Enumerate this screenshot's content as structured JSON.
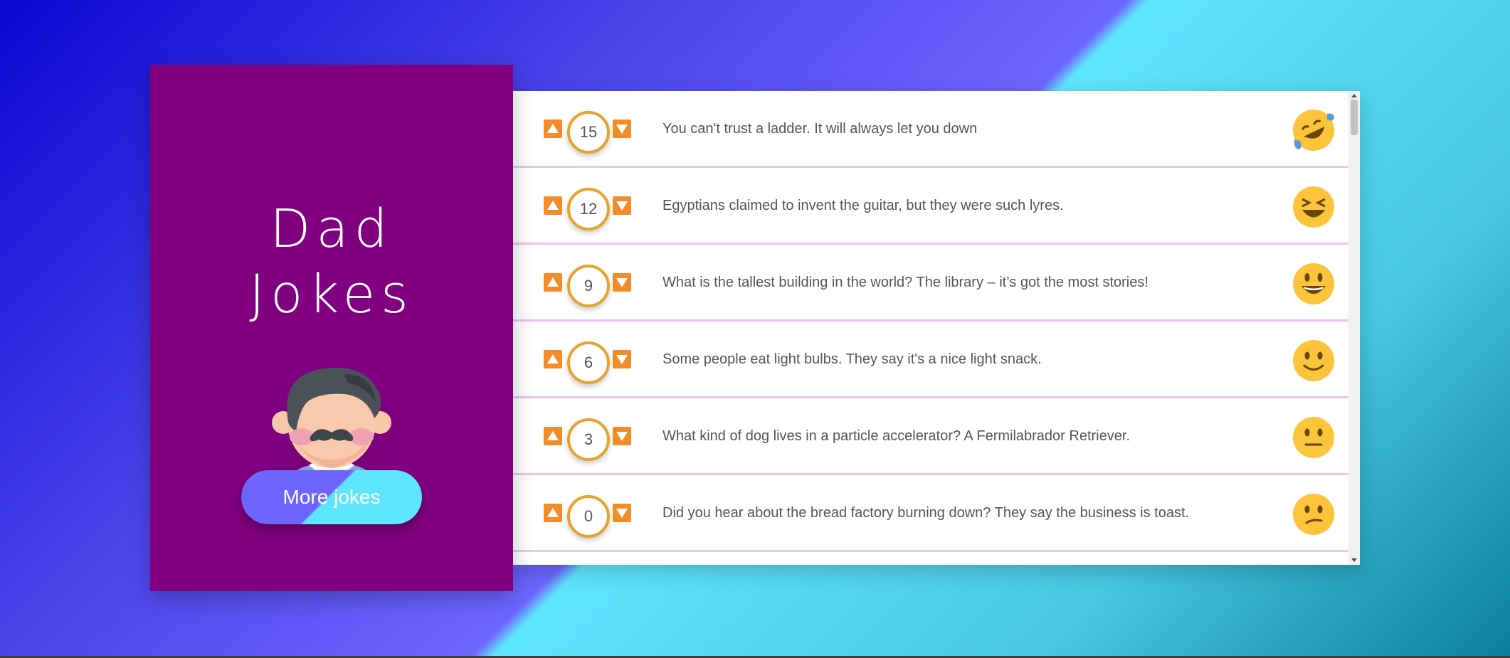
{
  "app": {
    "title_line1": "Dad",
    "title_line2": "Jokes",
    "more_button_label": "More jokes"
  },
  "colors": {
    "sidebar": "#800080",
    "accent_purple": "#6e65ff",
    "accent_cyan": "#5fe6ff",
    "score_border": "#e5a32d",
    "vote_arrow": "#f28c28",
    "row_divider": "#e9c6ea"
  },
  "jokes": [
    {
      "score": "15",
      "text": "You can't trust a ladder. It will always let you down",
      "emoji": "rolling-on-floor-laughing-icon"
    },
    {
      "score": "12",
      "text": "Egyptians claimed to invent the guitar, but they were such lyres.",
      "emoji": "laughing-squint-icon"
    },
    {
      "score": "9",
      "text": "What is the tallest building in the world? The library – it’s got the most stories!",
      "emoji": "big-smile-icon"
    },
    {
      "score": "6",
      "text": "Some people eat light bulbs. They say it's a nice light snack.",
      "emoji": "slight-smile-icon"
    },
    {
      "score": "3",
      "text": "What kind of dog lives in a particle accelerator? A Fermilabrador Retriever.",
      "emoji": "neutral-face-icon"
    },
    {
      "score": "0",
      "text": "Did you hear about the bread factory burning down? They say the business is toast.",
      "emoji": "confused-face-icon"
    }
  ]
}
